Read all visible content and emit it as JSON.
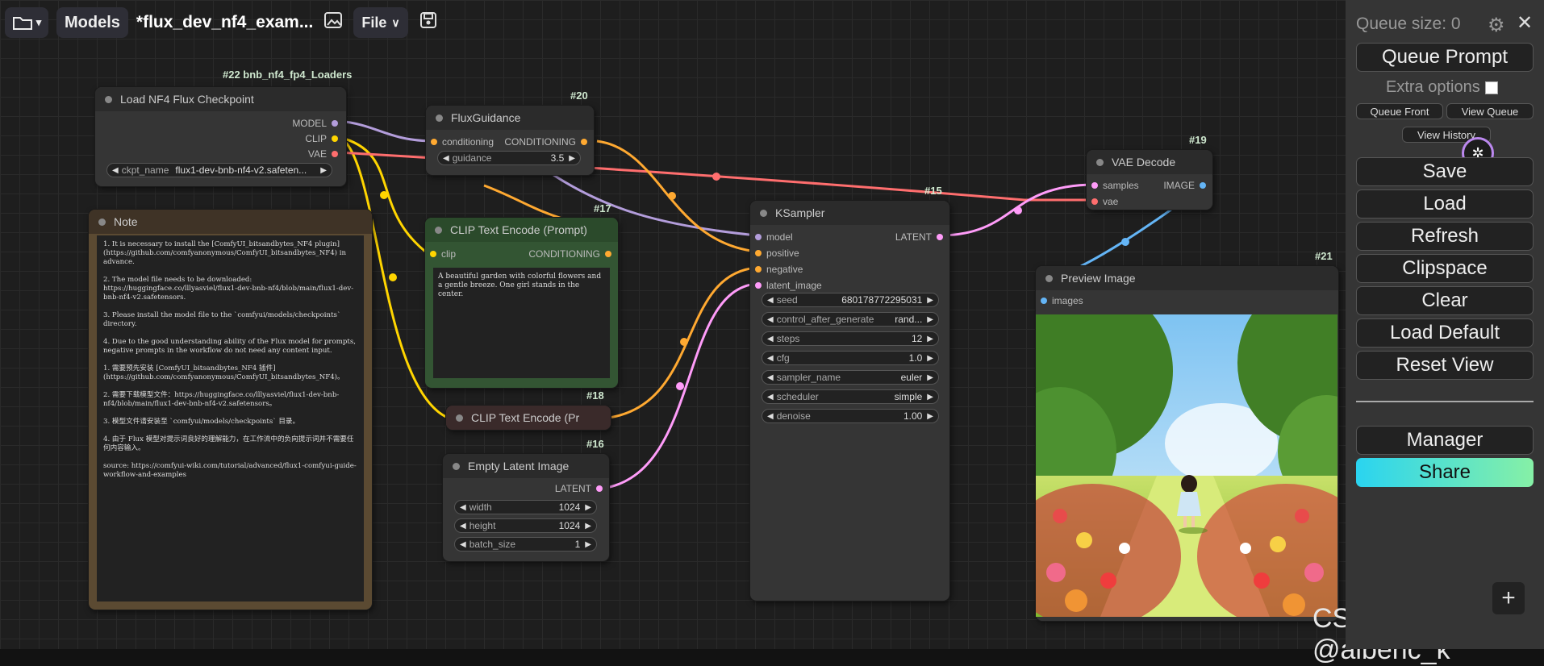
{
  "topbar": {
    "workflows_label": "▾",
    "models_label": "Models",
    "title": "*flux_dev_nf4_exam...",
    "file_label": "File"
  },
  "colors": {
    "model_link": "#b39ddb",
    "clip_link": "#ffd500",
    "vae_link": "#ff6e6e",
    "conditioning_link": "#ffa931",
    "latent_link": "#ff9cf9",
    "image_link": "#64b5f6",
    "note_bg": "#3f3326",
    "clip_node_bg": "#2b4a2b"
  },
  "nodes": {
    "loader": {
      "id": "#22 bnb_nf4_fp4_Loaders",
      "title": "Load NF4 Flux Checkpoint",
      "out_model": "MODEL",
      "out_clip": "CLIP",
      "out_vae": "VAE",
      "w_label": "ckpt_name",
      "w_value": "flux1-dev-bnb-nf4-v2.safeten..."
    },
    "note": {
      "title": "Note",
      "text": "1. It is necessary to install the [ComfyUI_bitsandbytes_NF4 plugin]\n(https://github.com/comfyanonymous/ComfyUI_bitsandbytes_NF4) in advance.\n\n2. The model file needs to be downloaded:\nhttps://huggingface.co/lllyasviel/flux1-dev-bnb-nf4/blob/main/flux1-dev-bnb-nf4-v2.safetensors.\n\n3. Please install the model file to the `comfyui/models/checkpoints` directory.\n\n4. Due to the good understanding ability of the Flux model for prompts, negative prompts in the workflow do not need any content input.\n\n1. 需要预先安装 [ComfyUI_bitsandbytes_NF4 插件]\n(https://github.com/comfyanonymous/ComfyUI_bitsandbytes_NF4)。\n\n2. 需要下载模型文件：https://huggingface.co/lllyasviel/flux1-dev-bnb-nf4/blob/main/flux1-dev-bnb-nf4-v2.safetensors。\n\n3. 模型文件请安装至 `comfyui/models/checkpoints` 目录。\n\n4. 由于 Flux 模型对提示词良好的理解能力，在工作流中的负向提示词并不需要任何内容输入。\n\nsource: https://comfyui-wiki.com/tutorial/advanced/flux1-comfyui-guide-workflow-and-examples"
    },
    "guidance": {
      "id": "#20",
      "title": "FluxGuidance",
      "in_label": "conditioning",
      "out_label": "CONDITIONING",
      "w_label": "guidance",
      "w_value": "3.5"
    },
    "clip_pos": {
      "id": "#17",
      "title": "CLIP Text Encode (Prompt)",
      "in_label": "clip",
      "out_label": "CONDITIONING",
      "text": "A beautiful garden with colorful flowers and a gentle breeze. One girl stands in the center."
    },
    "clip_neg": {
      "id": "#18",
      "title": "CLIP Text Encode (Pr"
    },
    "latent": {
      "id": "#16",
      "title": "Empty Latent Image",
      "out_label": "LATENT",
      "widgets": [
        {
          "label": "width",
          "value": "1024"
        },
        {
          "label": "height",
          "value": "1024"
        },
        {
          "label": "batch_size",
          "value": "1"
        }
      ]
    },
    "ksampler": {
      "id": "#15",
      "title": "KSampler",
      "in_model": "model",
      "in_positive": "positive",
      "in_negative": "negative",
      "in_latent": "latent_image",
      "out_label": "LATENT",
      "widgets": [
        {
          "label": "seed",
          "value": "680178772295031"
        },
        {
          "label": "control_after_generate",
          "value": "rand..."
        },
        {
          "label": "steps",
          "value": "12"
        },
        {
          "label": "cfg",
          "value": "1.0"
        },
        {
          "label": "sampler_name",
          "value": "euler"
        },
        {
          "label": "scheduler",
          "value": "simple"
        },
        {
          "label": "denoise",
          "value": "1.00"
        }
      ]
    },
    "vae": {
      "id": "#19",
      "title": "VAE Decode",
      "in_samples": "samples",
      "in_vae": "vae",
      "out_label": "IMAGE"
    },
    "preview": {
      "id": "#21",
      "title": "Preview Image",
      "in_label": "images"
    }
  },
  "panel": {
    "queue_size": "Queue size: 0",
    "queue_prompt": "Queue Prompt",
    "extra_options": "Extra options",
    "queue_front": "Queue Front",
    "view_queue": "View Queue",
    "view_history": "View History",
    "buttons": [
      "Save",
      "Load",
      "Refresh",
      "Clipspace",
      "Clear",
      "Load Default",
      "Reset View"
    ],
    "manager": "Manager",
    "share": "Share"
  },
  "watermark": "CSDN @alberic_k"
}
